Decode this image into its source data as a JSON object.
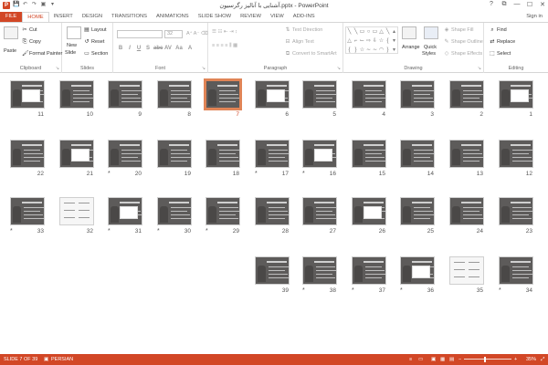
{
  "window": {
    "title": "آشنایی با آنالیز رگرسیون.pptx - PowerPoint",
    "controls": [
      "?",
      "⧉",
      "—",
      "☐",
      "✕"
    ]
  },
  "qat": [
    "💾",
    "↶",
    "↷",
    "▣",
    "▾"
  ],
  "tabs": [
    "FILE",
    "HOME",
    "INSERT",
    "DESIGN",
    "TRANSITIONS",
    "ANIMATIONS",
    "SLIDE SHOW",
    "REVIEW",
    "VIEW",
    "ADD-INS"
  ],
  "signin": "Sign in",
  "ribbon": {
    "clipboard": {
      "label": "Clipboard",
      "paste": "Paste",
      "cut": "Cut",
      "copy": "Copy",
      "format_painter": "Format Painter"
    },
    "slides": {
      "label": "Slides",
      "new_slide": "New",
      "new_slide2": "Slide",
      "layout": "Layout",
      "reset": "Reset",
      "section": "Section"
    },
    "font": {
      "label": "Font",
      "size": "32",
      "buttons": [
        "B",
        "I",
        "U",
        "S",
        "abc",
        "AV",
        "Aa",
        "A"
      ]
    },
    "paragraph": {
      "label": "Paragraph",
      "text_direction": "Text Direction",
      "align_text": "Align Text",
      "convert_smartart": "Convert to SmartArt"
    },
    "drawing": {
      "label": "Drawing",
      "arrange": "Arrange",
      "quick_styles": "Quick",
      "quick_styles2": "Styles",
      "shape_fill": "Shape Fill",
      "shape_outline": "Shape Outline",
      "shape_effects": "Shape Effects"
    },
    "editing": {
      "label": "Editing",
      "find": "Find",
      "replace": "Replace",
      "select": "Select"
    }
  },
  "slides": [
    {
      "n": "1"
    },
    {
      "n": "2"
    },
    {
      "n": "3"
    },
    {
      "n": "4"
    },
    {
      "n": "5"
    },
    {
      "n": "6"
    },
    {
      "n": "7"
    },
    {
      "n": "8"
    },
    {
      "n": "9"
    },
    {
      "n": "10"
    },
    {
      "n": "11"
    },
    {
      "n": "12"
    },
    {
      "n": "13"
    },
    {
      "n": "14"
    },
    {
      "n": "15"
    },
    {
      "n": "16"
    },
    {
      "n": "17"
    },
    {
      "n": "18"
    },
    {
      "n": "19"
    },
    {
      "n": "20"
    },
    {
      "n": "21"
    },
    {
      "n": "22"
    },
    {
      "n": "23"
    },
    {
      "n": "24"
    },
    {
      "n": "25"
    },
    {
      "n": "26"
    },
    {
      "n": "27"
    },
    {
      "n": "28"
    },
    {
      "n": "29"
    },
    {
      "n": "30"
    },
    {
      "n": "31"
    },
    {
      "n": "32"
    },
    {
      "n": "33"
    },
    {
      "n": "34"
    },
    {
      "n": "35"
    },
    {
      "n": "36"
    },
    {
      "n": "37"
    },
    {
      "n": "38"
    },
    {
      "n": "39"
    }
  ],
  "star_glyph": "*",
  "status": {
    "slide": "SLIDE 7 OF 39",
    "language": "PERSIAN",
    "zoom": "35%",
    "minus": "−",
    "plus": "+"
  }
}
